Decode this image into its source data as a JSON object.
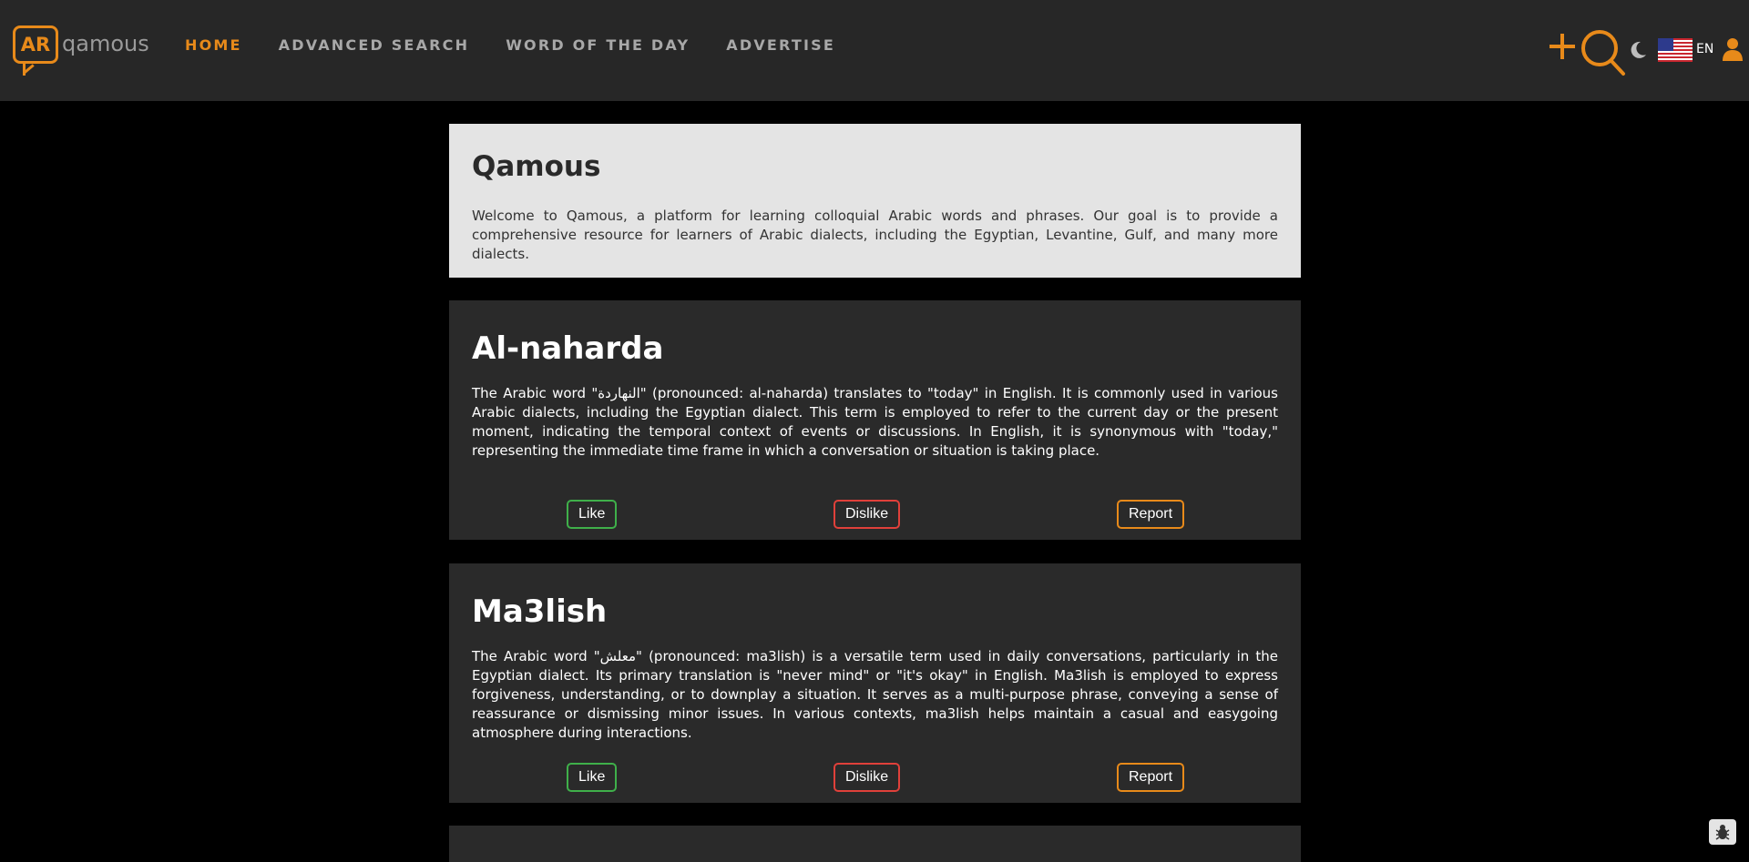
{
  "header": {
    "logo_badge": "AR",
    "logo_text": "qamous",
    "nav": [
      {
        "label": "HOME",
        "active": true
      },
      {
        "label": "ADVANCED SEARCH",
        "active": false
      },
      {
        "label": "WORD OF THE DAY",
        "active": false
      },
      {
        "label": "ADVERTISE",
        "active": false
      }
    ],
    "icons": [
      "plus-icon",
      "search-icon",
      "moon-icon",
      "us-flag-icon",
      "user-icon"
    ],
    "language": "EN"
  },
  "intro": {
    "title": "Qamous",
    "text": "Welcome to Qamous, a platform for learning colloquial Arabic words and phrases. Our goal is to provide a comprehensive resource for learners of Arabic dialects, including the Egyptian, Levantine, Gulf, and many more dialects."
  },
  "words": [
    {
      "title": "Al-naharda",
      "text": "The Arabic word \"النهاردة\" (pronounced: al-naharda) translates to \"today\" in English. It is commonly used in various Arabic dialects, including the Egyptian dialect. This term is employed to refer to the current day or the present moment, indicating the temporal context of events or discussions. In English, it is synonymous with \"today,\" representing the immediate time frame in which a conversation or situation is taking place.",
      "like_label": "Like",
      "dislike_label": "Dislike",
      "report_label": "Report"
    },
    {
      "title": "Ma3lish",
      "text": "The Arabic word \"معلش\" (pronounced: ma3lish) is a versatile term used in daily conversations, particularly in the Egyptian dialect. Its primary translation is \"never mind\" or \"it's okay\" in English. Ma3lish is employed to express forgiveness, understanding, or to downplay a situation. It serves as a multi-purpose phrase, conveying a sense of reassurance or dismissing minor issues. In various contexts, ma3lish helps maintain a casual and easygoing atmosphere during interactions.",
      "like_label": "Like",
      "dislike_label": "Dislike",
      "report_label": "Report"
    }
  ],
  "colors": {
    "accent": "#e88a1a",
    "like": "#3fb04a",
    "dislike": "#e0403a",
    "header_bg": "#272727",
    "card_bg": "#2a2a2a",
    "intro_bg": "#e4e4e4"
  }
}
